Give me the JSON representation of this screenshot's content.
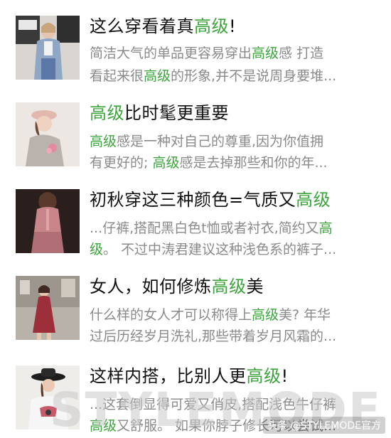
{
  "colors": {
    "highlight": "#3ca43c",
    "title_text": "#111111",
    "desc_text": "#8a8a8a"
  },
  "articles": [
    {
      "title_before": "这么穿看着真",
      "title_highlight": "高级",
      "title_after": "!",
      "desc_line1_before": "简洁大气的单品更容易穿出",
      "desc_line1_highlight": "高级",
      "desc_line1_after": "感 打造",
      "desc_line2_before": "看起来很",
      "desc_line2_highlight": "高级",
      "desc_line2_after": "的形象,并不是说周身要堆..."
    },
    {
      "title_before": "",
      "title_highlight": "高级",
      "title_after": "比时髦更重要",
      "desc_line1_before": "",
      "desc_line1_highlight": "高级",
      "desc_line1_after": "感是一种对自己的尊重,因为你值拥",
      "desc_line2_before": "有更好的; ",
      "desc_line2_highlight": "高级",
      "desc_line2_after": "感是去掉那些和你的年..."
    },
    {
      "title_before": "初秋穿这三种颜色=气质又",
      "title_highlight": "高级",
      "title_after": "",
      "desc_line1_before": "...仔裤,搭配黑白色t恤或者衬衣,简约又",
      "desc_line1_highlight": "高",
      "desc_line1_after": "",
      "desc_line2_before": "",
      "desc_line2_highlight": "级",
      "desc_line2_after": "。 不过中涛君建议这种浅色系的裤子..."
    },
    {
      "title_before": "女人，如何修炼",
      "title_highlight": "高级",
      "title_after": "美",
      "desc_line1_before": "什么样的女人才可以称得上",
      "desc_line1_highlight": "高级",
      "desc_line1_after": "美? 年华",
      "desc_line2_before": "过后历经岁月洗礼,那些带着岁月风霜的...",
      "desc_line2_highlight": "",
      "desc_line2_after": ""
    },
    {
      "title_before": "这样内搭，比别人更",
      "title_highlight": "高级",
      "title_after": "!",
      "desc_line1_before": "...这套倒显得可爱又俏皮,搭配浅色牛仔裤",
      "desc_line1_highlight": "",
      "desc_line1_after": "",
      "desc_line2_before": "",
      "desc_line2_highlight": "高级",
      "desc_line2_after": "又舒服。 如果你脖子",
      "desc_line2_tail": "修长可以尝试..."
    }
  ],
  "thumbnails": [
    {
      "icon": "woman-denim-jacket-photo"
    },
    {
      "icon": "woman-beret-photo"
    },
    {
      "icon": "woman-pink-satin-photo"
    },
    {
      "icon": "woman-red-dress-photo"
    },
    {
      "icon": "woman-black-hat-photo"
    }
  ],
  "watermark": {
    "text": "STYLEMODE"
  },
  "source_badge": {
    "text": "头条 @STYLEMODE官方"
  }
}
